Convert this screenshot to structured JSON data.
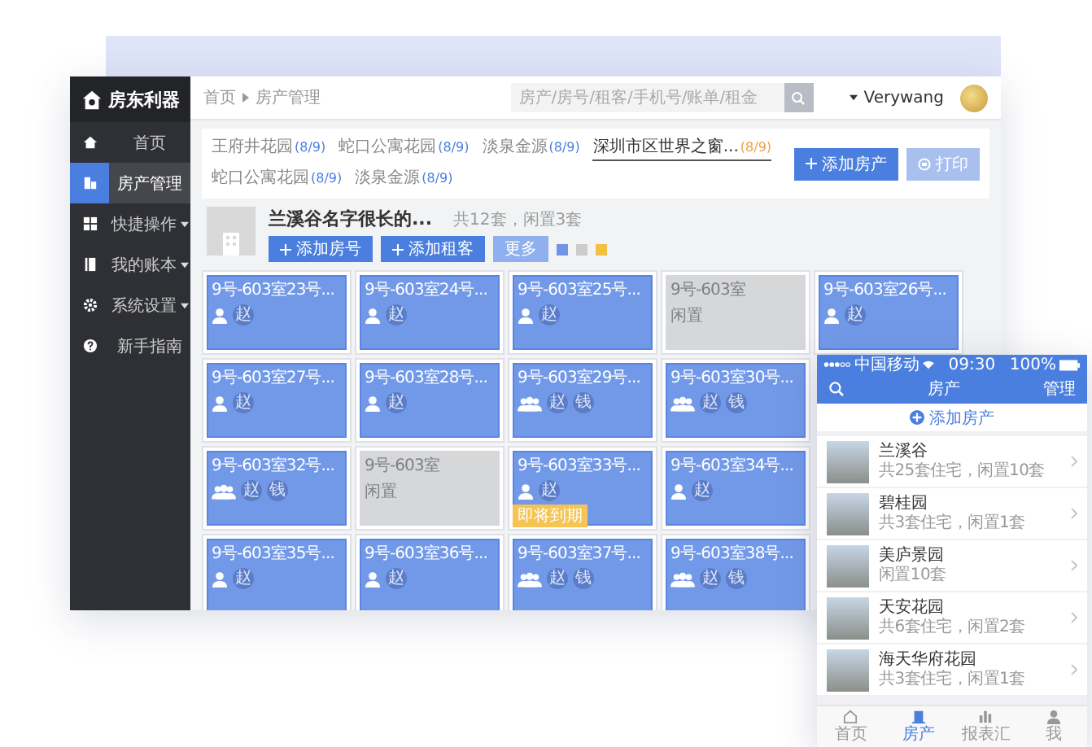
{
  "logo": {
    "text": "房东利器"
  },
  "sidebar": {
    "items": [
      {
        "label": "首页",
        "selected": false,
        "expandable": false
      },
      {
        "label": "房产管理",
        "selected": true,
        "expandable": false
      },
      {
        "label": "快捷操作",
        "selected": false,
        "expandable": true
      },
      {
        "label": "我的账本",
        "selected": false,
        "expandable": true
      },
      {
        "label": "系统设置",
        "selected": false,
        "expandable": true
      },
      {
        "label": "新手指南",
        "selected": false,
        "expandable": false
      }
    ]
  },
  "header": {
    "breadcrumb": [
      "首页",
      "房产管理"
    ],
    "search": {
      "placeholder": "房产/房号/租客/手机号/账单/租金"
    },
    "user": "Verywang"
  },
  "tabs": [
    {
      "label": "王府井花园",
      "count": "(8/9)",
      "selected": false
    },
    {
      "label": "蛇口公寓花园",
      "count": "(8/9)",
      "selected": false
    },
    {
      "label": "淡泉金源",
      "count": "(8/9)",
      "selected": false
    },
    {
      "label": "深圳市区世界之窗...",
      "count": "(8/9)",
      "selected": true
    },
    {
      "label": "蛇口公寓花园",
      "count": "(8/9)",
      "selected": false
    },
    {
      "label": "淡泉金源",
      "count": "(8/9)",
      "selected": false
    }
  ],
  "actions": [
    {
      "kind": "add",
      "label": "添加房产",
      "disabled": false
    },
    {
      "kind": "print",
      "label": "打印",
      "disabled": true
    }
  ],
  "property": {
    "name": "兰溪谷名字很长的...",
    "summary": "共12套，闲置3套",
    "buttons": [
      {
        "kind": "add",
        "label": "添加房号"
      },
      {
        "kind": "add",
        "label": "添加租客"
      },
      {
        "kind": "more",
        "label": "更多"
      }
    ]
  },
  "room_rows": [
    [
      {
        "title": "9号-603室23号...",
        "kind": "occupied",
        "shared": false,
        "tags": [
          "赵"
        ]
      },
      {
        "title": "9号-603室24号...",
        "kind": "occupied",
        "shared": false,
        "tags": [
          "赵"
        ]
      },
      {
        "title": "9号-603室25号...",
        "kind": "occupied",
        "shared": false,
        "tags": [
          "赵"
        ]
      },
      {
        "title": "9号-603室",
        "kind": "vacant",
        "status": "闲置"
      },
      {
        "title": "9号-603室26号...",
        "kind": "occupied",
        "shared": false,
        "tags": [
          "赵"
        ]
      }
    ],
    [
      {
        "title": "9号-603室27号...",
        "kind": "occupied",
        "shared": false,
        "tags": [
          "赵"
        ]
      },
      {
        "title": "9号-603室28号...",
        "kind": "occupied",
        "shared": false,
        "tags": [
          "赵"
        ]
      },
      {
        "title": "9号-603室29号...",
        "kind": "occupied",
        "shared": true,
        "tags": [
          "赵",
          "钱"
        ]
      },
      {
        "title": "9号-603室30号...",
        "kind": "occupied",
        "shared": true,
        "tags": [
          "赵",
          "钱"
        ]
      }
    ],
    [
      {
        "title": "9号-603室32号...",
        "kind": "occupied",
        "shared": true,
        "tags": [
          "赵",
          "钱"
        ]
      },
      {
        "title": "9号-603室",
        "kind": "vacant",
        "status": "闲置"
      },
      {
        "title": "9号-603室33号...",
        "kind": "occupied",
        "shared": false,
        "tags": [
          "赵"
        ],
        "badge": "即将到期"
      },
      {
        "title": "9号-603室34号...",
        "kind": "occupied",
        "shared": false,
        "tags": [
          "赵"
        ]
      }
    ],
    [
      {
        "title": "9号-603室35号...",
        "kind": "occupied",
        "shared": false,
        "tags": [
          "赵"
        ]
      },
      {
        "title": "9号-603室36号...",
        "kind": "occupied",
        "shared": false,
        "tags": [
          "赵"
        ]
      },
      {
        "title": "9号-603室37号...",
        "kind": "occupied",
        "shared": true,
        "tags": [
          "赵",
          "钱"
        ]
      },
      {
        "title": "9号-603室38号...",
        "kind": "occupied",
        "shared": true,
        "tags": [
          "赵",
          "钱"
        ]
      }
    ]
  ],
  "phone": {
    "status_bar": {
      "carrier": "中国移动",
      "time": "09:30",
      "battery": "100%"
    },
    "nav": {
      "title": "房产",
      "action": "管理"
    },
    "add_label": "添加房产",
    "properties": [
      {
        "name": "兰溪谷",
        "summary": "共25套住宅，闲置10套"
      },
      {
        "name": "碧桂园",
        "summary": "共3套住宅，闲置1套"
      },
      {
        "name": "美庐景园",
        "summary": "闲置10套"
      },
      {
        "name": "天安花园",
        "summary": "共6套住宅，闲置2套"
      },
      {
        "name": "海天华府花园",
        "summary": "共3套住宅，闲置1套"
      }
    ],
    "tabbar": [
      {
        "label": "首页",
        "selected": false
      },
      {
        "label": "房产",
        "selected": true
      },
      {
        "label": "报表汇",
        "selected": false
      },
      {
        "label": "我",
        "selected": false
      }
    ]
  }
}
